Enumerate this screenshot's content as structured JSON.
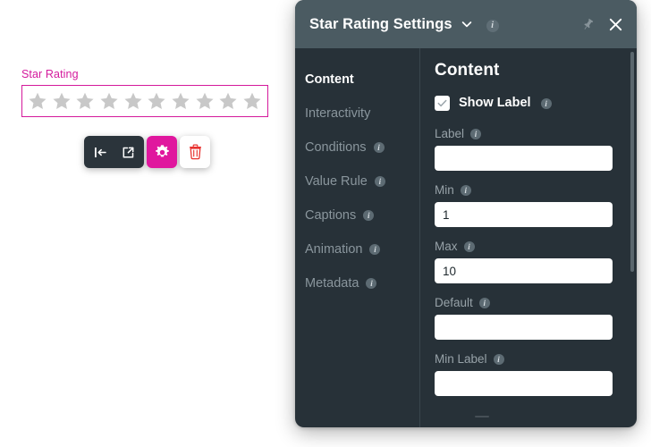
{
  "canvas": {
    "widget": {
      "label": "Star Rating",
      "star_count": 10,
      "star_color": "#c8c8c8",
      "accent_color": "#d4199c"
    },
    "toolbar": {
      "move_icon": "move-to-start-icon",
      "open_icon": "external-link-icon",
      "settings_icon": "gear-icon",
      "delete_icon": "trash-icon"
    }
  },
  "panel": {
    "header": {
      "title": "Star Rating Settings",
      "dropdown_icon": "chevron-down-icon",
      "info_icon": "info-icon",
      "pin_icon": "pin-icon",
      "close_icon": "close-icon",
      "bg_color": "#4b5b62"
    },
    "nav": {
      "items": [
        {
          "label": "Content",
          "active": true,
          "has_info": false
        },
        {
          "label": "Interactivity",
          "active": false,
          "has_info": false
        },
        {
          "label": "Conditions",
          "active": false,
          "has_info": true
        },
        {
          "label": "Value Rule",
          "active": false,
          "has_info": true
        },
        {
          "label": "Captions",
          "active": false,
          "has_info": true
        },
        {
          "label": "Animation",
          "active": false,
          "has_info": true
        },
        {
          "label": "Metadata",
          "active": false,
          "has_info": true
        }
      ]
    },
    "content": {
      "title": "Content",
      "show_label": {
        "label": "Show Label",
        "checked": true,
        "info_icon": "info-icon"
      },
      "fields": [
        {
          "label": "Label",
          "value": "",
          "placeholder": "",
          "has_info": true
        },
        {
          "label": "Min",
          "value": "1",
          "placeholder": "",
          "has_info": true
        },
        {
          "label": "Max",
          "value": "10",
          "placeholder": "",
          "has_info": true
        },
        {
          "label": "Default",
          "value": "",
          "placeholder": "",
          "has_info": true
        },
        {
          "label": "Min Label",
          "value": "",
          "placeholder": "",
          "has_info": true
        }
      ],
      "scrollbar": {
        "visible": true,
        "thumb_position": "top"
      }
    }
  },
  "colors": {
    "accent": "#d4199c",
    "panel_bg": "#273138",
    "header_bg": "#4b5b62",
    "nav_inactive": "#8a969d",
    "field_label": "#97a2a8"
  }
}
